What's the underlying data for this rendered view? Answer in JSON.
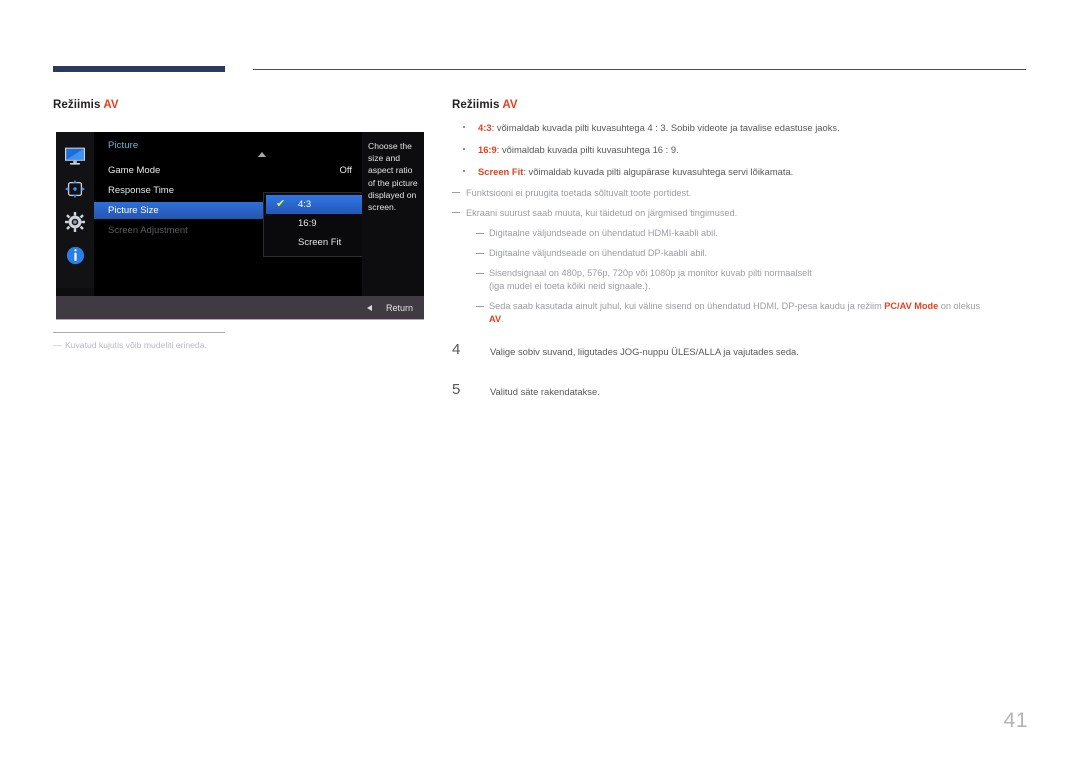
{
  "page": {
    "number": "41"
  },
  "left_column": {
    "heading_prefix": "Režiimis ",
    "heading_mode": "AV",
    "footnote": {
      "dash": "―",
      "text": "Kuvatud kujutis võib mudeliti erineda."
    }
  },
  "osd": {
    "title": "Picture",
    "icons": [
      {
        "name": "monitor-icon",
        "label": "Picture"
      },
      {
        "name": "onscreen-display-icon",
        "label": "OnScreen Display"
      },
      {
        "name": "gear-icon",
        "label": "System"
      },
      {
        "name": "information-icon",
        "label": "Information"
      }
    ],
    "rows": [
      {
        "label": "Game Mode",
        "value": "Off",
        "state": "normal"
      },
      {
        "label": "Response Time",
        "value": "",
        "state": "normal"
      },
      {
        "label": "Picture Size",
        "value": "",
        "state": "selected"
      },
      {
        "label": "Screen Adjustment",
        "value": "",
        "state": "disabled"
      }
    ],
    "submenu": {
      "items": [
        {
          "label": "4:3",
          "checked": true,
          "active": true
        },
        {
          "label": "16:9",
          "checked": false,
          "active": false
        },
        {
          "label": "Screen Fit",
          "checked": false,
          "active": false
        }
      ],
      "check_glyph": "✔"
    },
    "help_text": "Choose the size and aspect ratio of the picture displayed on screen.",
    "bottom_bar": {
      "return_label": "Return",
      "arrow_icon": "left-arrow-icon"
    },
    "scroll_indicator": "scroll-up-arrow-icon"
  },
  "right_column": {
    "heading_prefix": "Režiimis ",
    "heading_mode": "AV",
    "bullets": [
      {
        "term": "4:3",
        "text": ": võimaldab kuvada pilti kuvasuhtega 4 : 3. Sobib videote ja tavalise edastuse jaoks."
      },
      {
        "term": "16:9",
        "text": ": võimaldab kuvada pilti kuvasuhtega 16 : 9."
      },
      {
        "term": "Screen Fit",
        "text": ": võimaldab kuvada pilti algupärase kuvasuhtega servi lõikamata."
      }
    ],
    "notes": [
      "Funktsiooni ei pruugita toetada sõltuvalt toote portidest.",
      "Ekraani suurust saab muuta, kui täidetud on järgmised tingimused."
    ],
    "subnotes": [
      {
        "text": "Digitaalne väljundseade on ühendatud HDMI-kaabli abil.",
        "continuation": "",
        "hl_before": "",
        "hl": "",
        "hl_after": ""
      },
      {
        "text": "Digitaalne väljundseade on ühendatud DP-kaabli abil.",
        "continuation": "",
        "hl_before": "",
        "hl": "",
        "hl_after": ""
      },
      {
        "text": "Sisendsignaal on 480p, 576p, 720p või 1080p ja monitor kuvab pilti normaalselt",
        "continuation": "(iga mudel ei toeta kõiki neid signaale.).",
        "hl_before": "",
        "hl": "",
        "hl_after": ""
      },
      {
        "text": "",
        "continuation": "",
        "hl_before": "Seda saab kasutada ainult juhul, kui väline sisend on ühendatud HDMI, DP-pesa kaudu ja režiim ",
        "hl": "PC/AV Mode",
        "hl_after": " on olekus"
      }
    ],
    "subnote_last_line": {
      "hl": "AV",
      "after": "."
    },
    "steps": [
      {
        "number": "4",
        "text": "Valige sobiv suvand, liigutades JOG-nuppu ÜLES/ALLA ja vajutades seda."
      },
      {
        "number": "5",
        "text": "Valitud säte rakendatakse."
      }
    ]
  }
}
